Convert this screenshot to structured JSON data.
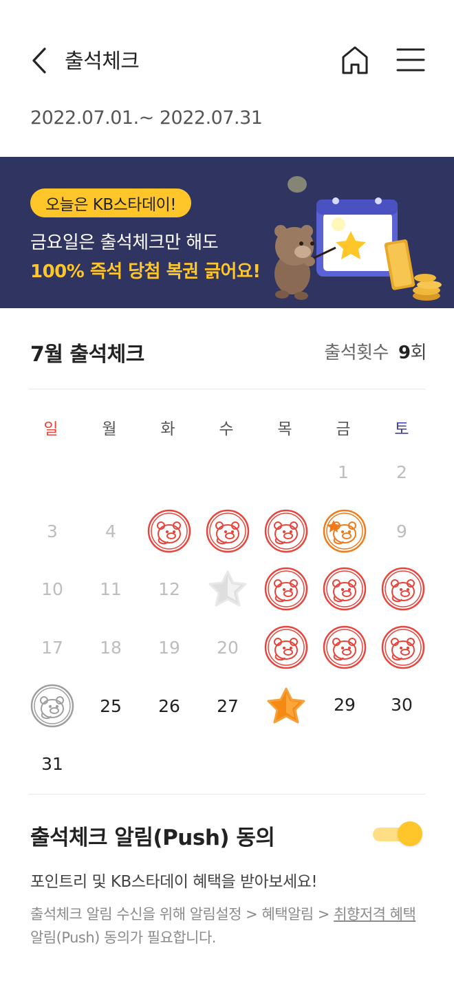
{
  "header": {
    "title": "출석체크",
    "period": "2022.07.01.~ 2022.07.31"
  },
  "banner": {
    "badge": "오늘은 KB스타데이!",
    "line1": "금요일은 출석체크만 해도",
    "line2": "100% 즉석 당첨 복권 긁어요!"
  },
  "attendance": {
    "month_title": "7월 출석체크",
    "count_label": "출석횟수",
    "count_value": "9",
    "count_unit": "회"
  },
  "calendar": {
    "weekdays": [
      "일",
      "월",
      "화",
      "수",
      "목",
      "금",
      "토"
    ],
    "days": {
      "d1": "1",
      "d2": "2",
      "d3": "3",
      "d4": "4",
      "d9": "9",
      "d10": "10",
      "d11": "11",
      "d12": "12",
      "d17": "17",
      "d18": "18",
      "d19": "19",
      "d20": "20",
      "d25": "25",
      "d26": "26",
      "d27": "27",
      "d29": "29",
      "d30": "30",
      "d31": "31"
    },
    "colors": {
      "attended_stamp": "#e8443b",
      "friday_stamp": "#f07a1a",
      "missed_stamp": "#9e9e9e",
      "sunday": "#e8443b",
      "saturday": "#3d3fa0"
    }
  },
  "push": {
    "title": "출석체크 알림(Push) 동의",
    "toggle_on": true,
    "description": "포인트리 및 KB스타데이 혜택을 받아보세요!",
    "note_prefix": "출석체크 알림 수신을 위해 알림설정 > 혜택알림 > ",
    "note_link": "취향저격 혜택",
    "note_suffix": "알림(Push) 동의가 필요합니다."
  },
  "icons": {
    "back": "chevron-left-icon",
    "home": "home-icon",
    "menu": "hamburger-menu-icon",
    "stamp": "bear-stamp-icon",
    "star": "star-icon"
  }
}
